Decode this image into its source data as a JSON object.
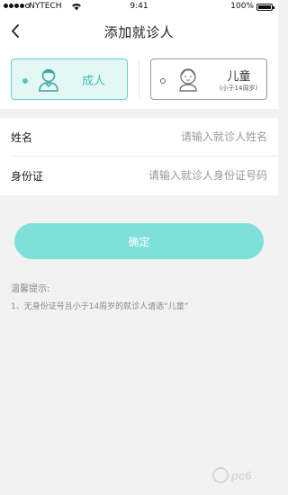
{
  "status_bar": {
    "carrier": "NYTECH",
    "time": "9:41",
    "battery": "100%"
  },
  "header": {
    "title": "添加就诊人",
    "back_icon": "chevron-left-icon"
  },
  "patient_type": {
    "adult": {
      "label": "成人",
      "selected": true,
      "icon": "adult-avatar-icon"
    },
    "child": {
      "label": "儿童",
      "sublabel": "(小于14周岁)",
      "selected": false,
      "icon": "child-avatar-icon"
    }
  },
  "form": {
    "name": {
      "label": "姓名",
      "value": "",
      "placeholder": "请输入就诊人姓名"
    },
    "id_number": {
      "label": "身份证",
      "value": "",
      "placeholder": "请输入就诊人身份证号码"
    }
  },
  "confirm_button": {
    "label": "确定"
  },
  "tips": {
    "title": "温馨提示:",
    "items": [
      "1、无身份证号且小于14周岁的就诊人请选“儿童”"
    ]
  },
  "colors": {
    "accent": "#63d2c9",
    "accent_light": "#e4f7f5",
    "button": "#7ee0d8",
    "background": "#f2f2f2"
  }
}
